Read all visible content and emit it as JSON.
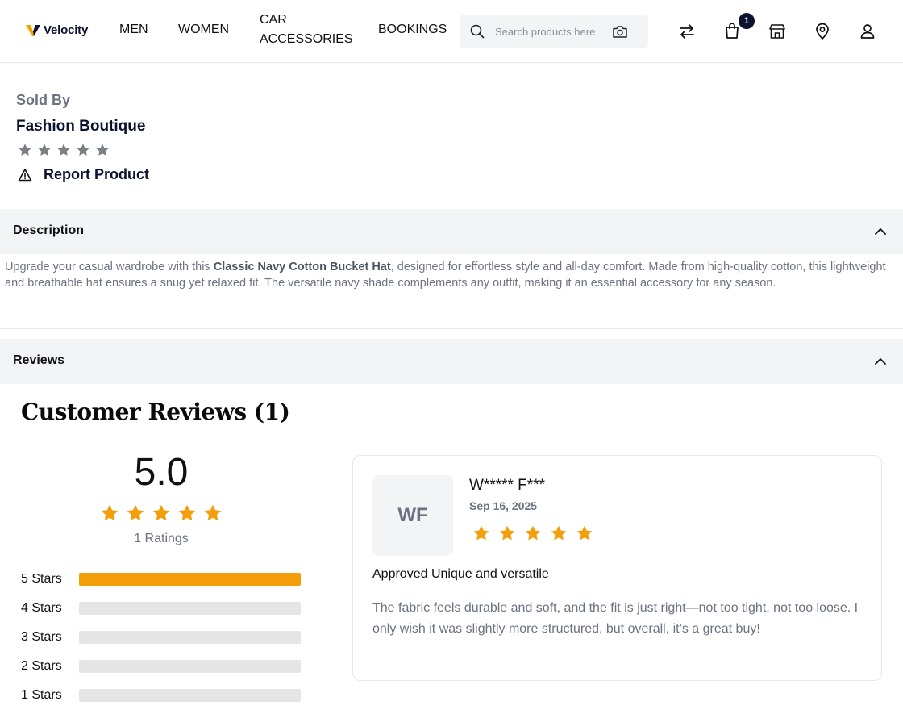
{
  "header": {
    "brand": "Velocity",
    "nav": [
      "MEN",
      "WOMEN",
      "CAR ACCESSORIES",
      "BOOKINGS"
    ],
    "search_placeholder": "Search products here",
    "cart_count": "1",
    "icons": [
      "compare-icon",
      "cart-icon",
      "store-icon",
      "location-icon",
      "user-icon"
    ]
  },
  "seller": {
    "label": "Sold By",
    "name": "Fashion Boutique",
    "rating_stars": 5,
    "report_label": "Report Product"
  },
  "description": {
    "title": "Description",
    "text_before": "Upgrade your casual wardrobe with this ",
    "product_name": "Classic Navy Cotton Bucket Hat",
    "text_after": ", designed for effortless style and all-day comfort. Made from high-quality cotton, this lightweight and breathable hat ensures a snug yet relaxed fit. The versatile navy shade complements any outfit, making it an essential accessory for any season."
  },
  "reviews": {
    "section_title": "Reviews",
    "heading": "Customer Reviews (1)",
    "average": "5.0",
    "average_stars": 5,
    "ratings_count": "1 Ratings",
    "breakdown": [
      {
        "label": "5 Stars",
        "fraction": 1
      },
      {
        "label": "4 Stars",
        "fraction": 0
      },
      {
        "label": "3 Stars",
        "fraction": 0
      },
      {
        "label": "2 Stars",
        "fraction": 0
      },
      {
        "label": "1 Stars",
        "fraction": 0
      }
    ],
    "items": [
      {
        "initials": "WF",
        "name": "W***** F***",
        "date": "Sep 16, 2025",
        "stars": 5,
        "title": "Approved Unique and versatile",
        "body": "The fabric feels durable and soft, and the fit is just right—not too tight, not too loose. I only wish it was slightly more structured, but overall, it’s a great buy!"
      }
    ]
  },
  "colors": {
    "brand_navy": "#0b1230",
    "star_gold": "#f59e0b",
    "star_gray": "#7b7f86"
  }
}
